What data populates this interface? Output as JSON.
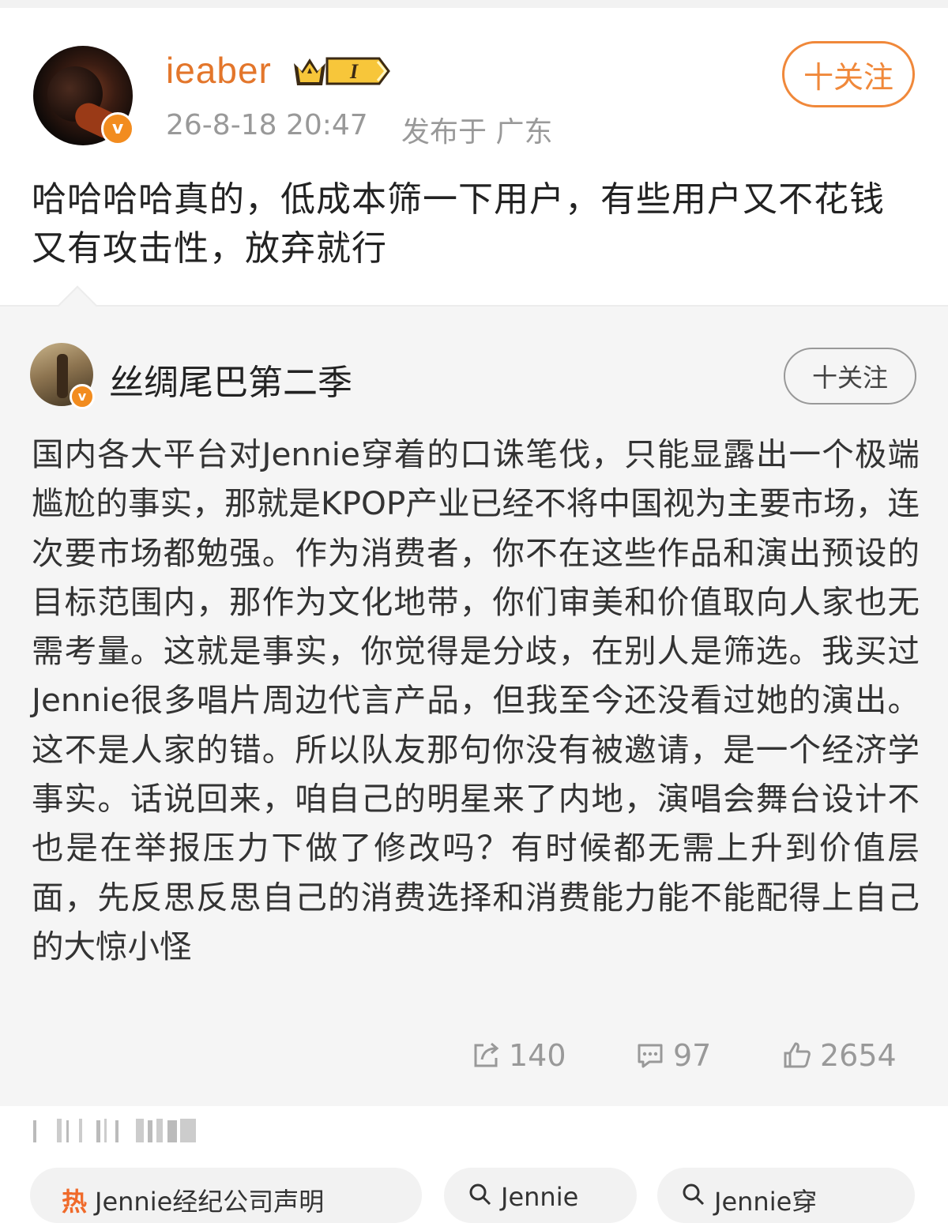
{
  "post": {
    "username": "ieaber",
    "vip_level": "I",
    "timestamp": "26-8-18 20:47",
    "location": "发布于 广东",
    "follow_label": "十关注",
    "text": "哈哈哈哈真的，低成本筛一下用户，有些用户又不花钱又有攻击性，放弃就行"
  },
  "quoted": {
    "username": "丝绸尾巴第二季",
    "follow_label": "十关注",
    "text": "国内各大平台对Jennie穿着的口诛笔伐，只能显露出一个极端尴尬的事实，那就是KPOP产业已经不将中国视为主要市场，连次要市场都勉强。作为消费者，你不在这些作品和演出预设的目标范围内，那作为文化地带，你们审美和价值取向人家也无需考量。这就是事实，你觉得是分歧，在别人是筛选。我买过Jennie很多唱片周边代言产品，但我至今还没看过她的演出。这不是人家的错。所以队友那句你没有被邀请，是一个经济学事实。话说回来，咱自己的明星来了内地，演唱会舞台设计不也是在举报压力下做了修改吗？有时候都无需上升到价值层面，先反思反思自己的消费选择和消费能力能不能配得上自己的大惊小怪",
    "stats": {
      "reposts": "140",
      "comments": "97",
      "likes": "2654"
    }
  },
  "related_chips": [
    {
      "icon": "hot-icon",
      "label": "Jennie经纪公司声明"
    },
    {
      "icon": "search-icon",
      "label": "Jennie"
    },
    {
      "icon": "search-icon",
      "label": "Jennie穿"
    }
  ],
  "colors": {
    "accent_orange": "#f0883a",
    "username_orange": "#e3762b",
    "verified_badge": "#f28c1f",
    "meta_gray": "#999999",
    "quote_bg": "#f5f5f5"
  }
}
